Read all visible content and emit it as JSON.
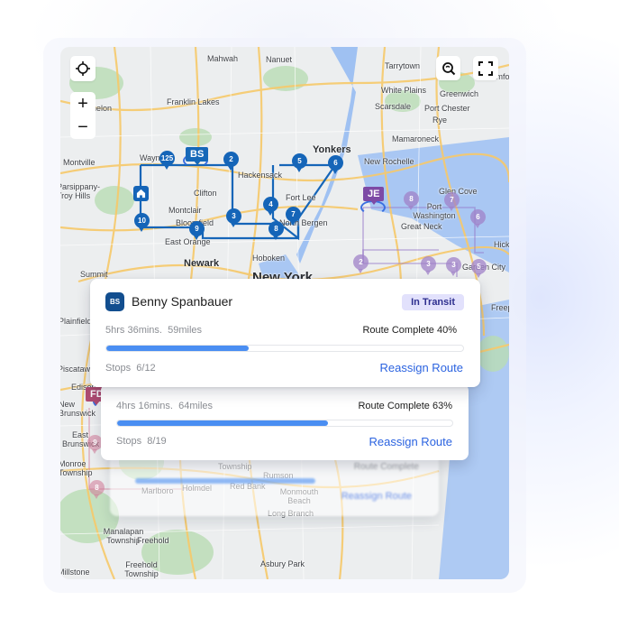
{
  "map": {
    "controls": {
      "locate": "crosshair-icon",
      "zoom_in": "+",
      "zoom_out": "−",
      "search_zoom": "search-zoom-icon",
      "fullscreen": "fullscreen-icon"
    },
    "labels": [
      {
        "text": "Mahwah"
      },
      {
        "text": "Nanuet"
      },
      {
        "text": "Tarrytown"
      },
      {
        "text": "White Plains"
      },
      {
        "text": "Greenwich"
      },
      {
        "text": "Scarsdale"
      },
      {
        "text": "Port Chester"
      },
      {
        "text": "Rye"
      },
      {
        "text": "Franklin Lakes"
      },
      {
        "text": "Kinnelon"
      },
      {
        "text": "Mamaroneck"
      },
      {
        "text": "Yonkers"
      },
      {
        "text": "New Rochelle"
      },
      {
        "text": "Montville"
      },
      {
        "text": "Wayne"
      },
      {
        "text": "Hackensack"
      },
      {
        "text": "Parsippany-Troy Hills"
      },
      {
        "text": "Clifton"
      },
      {
        "text": "Fort Lee"
      },
      {
        "text": "Glen Cove"
      },
      {
        "text": "Port Washington"
      },
      {
        "text": "Montclair"
      },
      {
        "text": "Bloomfield"
      },
      {
        "text": "North Bergen"
      },
      {
        "text": "Great Neck"
      },
      {
        "text": "East Orange"
      },
      {
        "text": "Hoboken"
      },
      {
        "text": "Newark"
      },
      {
        "text": "New York"
      },
      {
        "text": "Summit"
      },
      {
        "text": "Garden City"
      },
      {
        "text": "Hicksville"
      },
      {
        "text": "Plainfield"
      },
      {
        "text": "Freeport"
      },
      {
        "text": "Piscataway"
      },
      {
        "text": "Edison"
      },
      {
        "text": "New Brunswick"
      },
      {
        "text": "East Brunswick"
      },
      {
        "text": "Monroe Township"
      },
      {
        "text": "Township"
      },
      {
        "text": "Rumson"
      },
      {
        "text": "Marlboro"
      },
      {
        "text": "Holmdel"
      },
      {
        "text": "Red Bank"
      },
      {
        "text": "Monmouth Beach"
      },
      {
        "text": "Long Branch"
      },
      {
        "text": "Manalapan Township"
      },
      {
        "text": "Freehold"
      },
      {
        "text": "Freehold Township"
      },
      {
        "text": "Asbury Park"
      },
      {
        "text": "Millstone"
      },
      {
        "text": "Stamford"
      }
    ],
    "driver_tags": [
      {
        "initials": "BS",
        "color": "#1668b8"
      },
      {
        "initials": "JE",
        "color": "#7d4aa5"
      },
      {
        "initials": "FD",
        "color": "#b04c72"
      }
    ],
    "blue_route_stops": [
      "125",
      "2",
      "3",
      "4",
      "5",
      "6",
      "7",
      "8",
      "9",
      "10"
    ],
    "purple_route_stops": [
      "2",
      "3",
      "3",
      "5",
      "6",
      "7",
      "8"
    ],
    "pink_route_stops": [
      "8",
      "9"
    ]
  },
  "route_cards": [
    {
      "initials": "BS",
      "driver": "Benny Spanbauer",
      "status": "In Transit",
      "duration": "5hrs 36mins.",
      "distance": "59miles",
      "complete_label": "Route Complete 40%",
      "progress": 0.4,
      "stops_label": "Stops",
      "stops": "6/12",
      "action": "Reassign Route"
    },
    {
      "duration": "4hrs 16mins.",
      "distance": "64miles",
      "complete_label": "Route Complete 63%",
      "progress": 0.63,
      "stops_label": "Stops",
      "stops": "8/19",
      "action": "Reassign Route"
    },
    {
      "complete_label": "Route Complete",
      "action": "Reassign Route"
    }
  ],
  "colors": {
    "accent_blue": "#2b63e0",
    "progress_fill": "#4a8ef2",
    "route_blue": "#1565b8",
    "badge_bg": "#e2e1fc",
    "badge_text": "#2e2f8f"
  }
}
